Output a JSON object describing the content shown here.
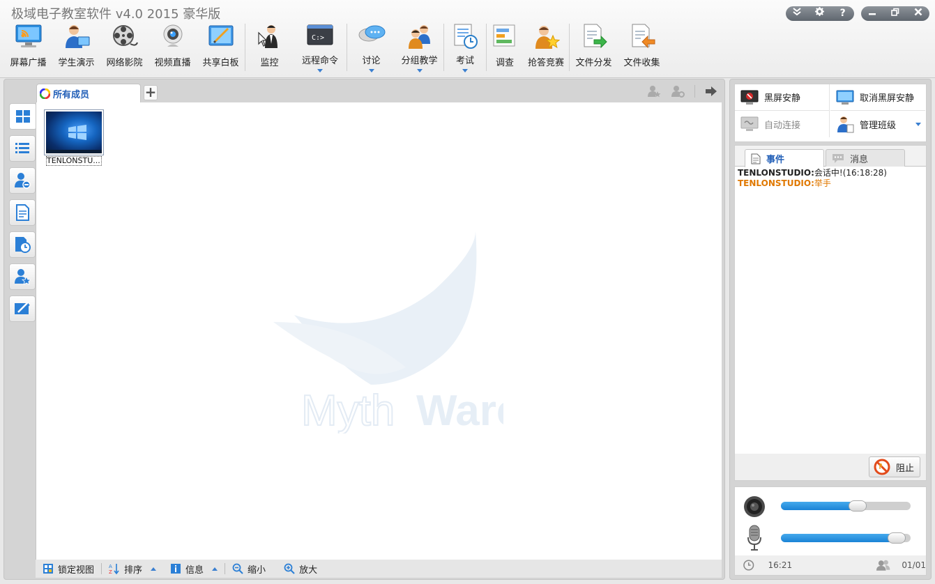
{
  "window": {
    "title": "极域电子教室软件 v4.0 2015 豪华版",
    "controls_left": [
      "collapse-icon",
      "gear-icon",
      "help-icon"
    ],
    "controls_right": [
      "minimize-icon",
      "restore-icon",
      "close-icon"
    ],
    "help_glyph": "?"
  },
  "toolbar": {
    "items": [
      {
        "label": "屏幕广播",
        "icon": "screen-broadcast-icon"
      },
      {
        "label": "学生演示",
        "icon": "student-demo-icon"
      },
      {
        "label": "网络影院",
        "icon": "film-reel-icon"
      },
      {
        "label": "视频直播",
        "icon": "webcam-icon"
      },
      {
        "label": "共享白板",
        "icon": "whiteboard-icon"
      },
      {
        "label": "监控",
        "icon": "monitor-icon"
      },
      {
        "label": "远程命令",
        "icon": "command-prompt-icon",
        "dropdown": true,
        "icon_text": "C:>"
      },
      {
        "label": "讨论",
        "icon": "discussion-icon",
        "dropdown": true
      },
      {
        "label": "分组教学",
        "icon": "group-teaching-icon",
        "dropdown": true
      },
      {
        "label": "考试",
        "icon": "exam-icon",
        "dropdown": true
      },
      {
        "label": "调查",
        "icon": "survey-icon"
      },
      {
        "label": "抢答竞赛",
        "icon": "quiz-icon"
      },
      {
        "label": "文件分发",
        "icon": "file-distribute-icon"
      },
      {
        "label": "文件收集",
        "icon": "file-collect-icon"
      }
    ]
  },
  "main": {
    "tab_label": "所有成员",
    "add_tab_glyph": "+",
    "students": [
      {
        "name": "TENLONSTU..."
      }
    ],
    "watermark": {
      "part1": "Myth",
      "part2": "Ware"
    }
  },
  "bottom_bar": {
    "lock_view": "锁定视图",
    "sort": "排序",
    "info": "信息",
    "zoom_out": "缩小",
    "zoom_in": "放大"
  },
  "controls": {
    "black_screen": "黑屏安静",
    "cancel_black_screen": "取消黑屏安静",
    "auto_connect": "自动连接",
    "manage_class": "管理班级"
  },
  "events": {
    "tab_events": "事件",
    "tab_messages": "消息",
    "log": [
      {
        "who": "TENLONSTUDIO:",
        "text": "会话中!(16:18:28)"
      },
      {
        "who": "TENLONSTUDIO:",
        "text": "举手"
      }
    ],
    "stop_label": "阻止"
  },
  "audio": {
    "speaker_level": 0.66,
    "mic_level": 0.96,
    "time": "16:21",
    "online_count": "01/01"
  },
  "colors": {
    "accent": "#2360b8",
    "warning": "#e07800",
    "slider_fill": "#1a83d6"
  }
}
